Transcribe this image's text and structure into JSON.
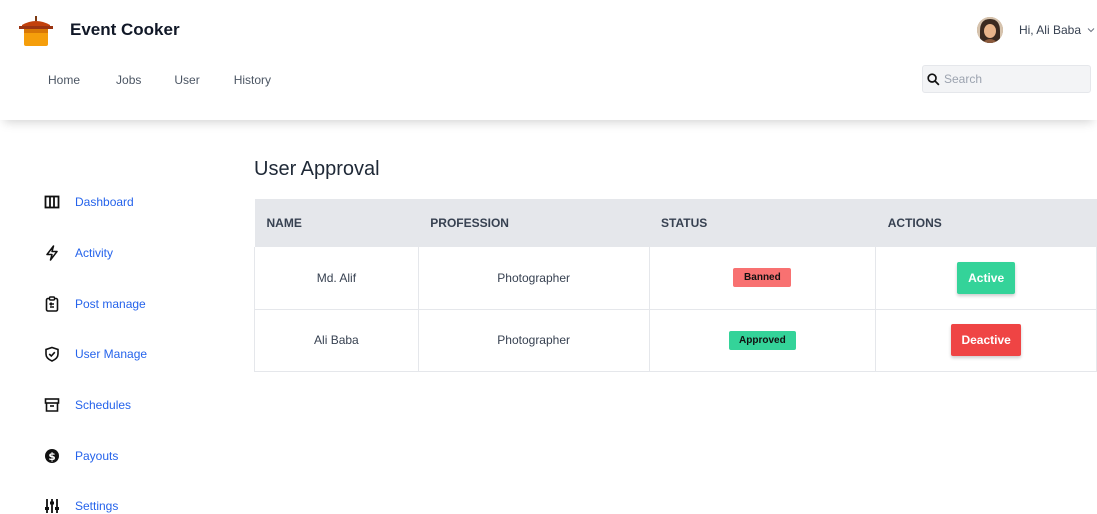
{
  "app": {
    "brand": "Event Cooker"
  },
  "nav": {
    "items": [
      "Home",
      "Jobs",
      "User",
      "History"
    ]
  },
  "user": {
    "greeting": "Hi, Ali Baba"
  },
  "search": {
    "placeholder": "Search"
  },
  "sidebar": {
    "items": [
      {
        "label": "Dashboard",
        "icon": "columns-icon"
      },
      {
        "label": "Activity",
        "icon": "lightning-icon"
      },
      {
        "label": "Post manage",
        "icon": "clipboard-icon"
      },
      {
        "label": "User Manage",
        "icon": "shield-check-icon"
      },
      {
        "label": "Schedules",
        "icon": "archive-icon"
      },
      {
        "label": "Payouts",
        "icon": "dollar-circle-icon"
      },
      {
        "label": "Settings",
        "icon": "sliders-icon"
      }
    ]
  },
  "main": {
    "title": "User Approval",
    "table": {
      "headers": [
        "NAME",
        "PROFESSION",
        "STATUS",
        "ACTIONS"
      ],
      "rows": [
        {
          "name": "Md. Alif",
          "profession": "Photographer",
          "status": "Banned",
          "action": "Active"
        },
        {
          "name": "Ali Baba",
          "profession": "Photographer",
          "status": "Approved",
          "action": "Deactive"
        }
      ]
    }
  },
  "colors": {
    "link": "#2563eb",
    "banned": "#f87171",
    "approved": "#34d399",
    "deactive": "#ef4444",
    "header_row": "#e5e7eb"
  }
}
